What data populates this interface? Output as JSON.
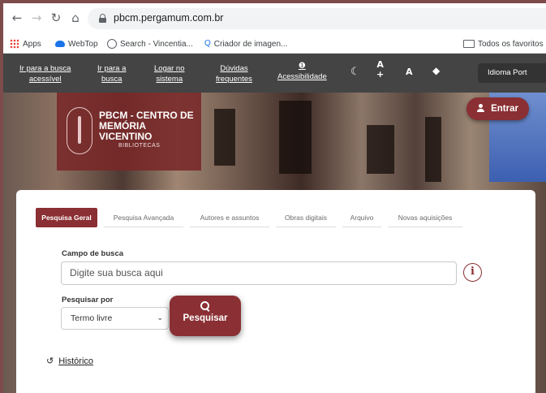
{
  "browser": {
    "url": "pbcm.pergamum.com.br",
    "bookmarks": [
      {
        "label": "Apps",
        "icon": "apps-grid-icon"
      },
      {
        "label": "WebTop",
        "icon": "cloud-icon"
      },
      {
        "label": "Search - Vincentia...",
        "icon": "globe-icon"
      },
      {
        "label": "Criador de imagen...",
        "icon": "search-icon"
      }
    ],
    "all_bookmarks": "Todos os favoritos"
  },
  "sitenav": {
    "links": [
      "Ir para a busca acessível",
      "Ir para a busca",
      "Logar no sistema",
      "Dúvidas frequentes",
      "Acessibilidade"
    ],
    "links_split": [
      [
        "Ir para a busca",
        "acessível"
      ],
      [
        "Ir para a",
        "busca"
      ],
      [
        "Logar no",
        "sistema"
      ],
      [
        "Dúvidas",
        "frequentes"
      ],
      [
        "",
        "Acessibilidade"
      ]
    ],
    "font_plus": "A",
    "font_plus_sign": "+",
    "font_normal": "A",
    "language": "Idioma Port"
  },
  "hero": {
    "title": "PBCM - CENTRO DE MEMÓRIA VICENTINO",
    "subtitle": "BIBLIOTECAS",
    "login_label": "Entrar"
  },
  "search": {
    "tabs": [
      "Pesquisa Geral",
      "Pesquisa Avançada",
      "Autores e assuntos",
      "Obras digitais",
      "Arquivo",
      "Novas aquisições"
    ],
    "field_label": "Campo de busca",
    "placeholder": "Digite sua busca aqui",
    "search_by_label": "Pesquisar por",
    "search_by_value": "Termo livre",
    "submit_label": "Pesquisar",
    "history_label": "Histórico"
  },
  "colors": {
    "brand": "#8a2f33",
    "nav_bg": "#444444",
    "page_bg": "#7d4b4b"
  }
}
